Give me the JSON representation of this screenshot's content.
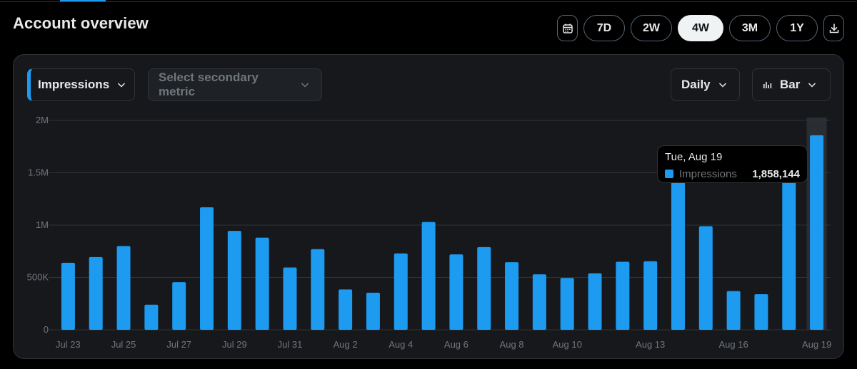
{
  "header": {
    "title": "Account overview",
    "range_buttons": [
      "7D",
      "2W",
      "4W",
      "3M",
      "1Y"
    ],
    "active_range": "4W"
  },
  "controls": {
    "primary_metric": "Impressions",
    "secondary_metric_placeholder": "Select secondary metric",
    "granularity": "Daily",
    "chart_type": "Bar"
  },
  "colors": {
    "accent": "#1d9bf0",
    "background": "#000000",
    "panel": "#16181c",
    "grid": "#2f3336",
    "muted_text": "#71767b"
  },
  "icons": [
    "calendar-icon",
    "download-icon",
    "chevron-down-icon",
    "bar-chart-icon"
  ],
  "tooltip": {
    "date": "Tue, Aug 19",
    "metric": "Impressions",
    "value": "1,858,144"
  },
  "chart_data": {
    "type": "bar",
    "series": [
      {
        "name": "Impressions",
        "values": [
          640000,
          695000,
          800000,
          240000,
          455000,
          1170000,
          945000,
          880000,
          595000,
          770000,
          385000,
          355000,
          730000,
          1030000,
          720000,
          790000,
          645000,
          530000,
          495000,
          540000,
          650000,
          655000,
          1620000,
          990000,
          370000,
          340000,
          1600000,
          1858144
        ]
      }
    ],
    "categories": [
      "Jul 23",
      "Jul 24",
      "Jul 25",
      "Jul 26",
      "Jul 27",
      "Jul 28",
      "Jul 29",
      "Jul 30",
      "Jul 31",
      "Aug 1",
      "Aug 2",
      "Aug 3",
      "Aug 4",
      "Aug 5",
      "Aug 6",
      "Aug 7",
      "Aug 8",
      "Aug 9",
      "Aug 10",
      "Aug 11",
      "Aug 12",
      "Aug 13",
      "Aug 14",
      "Aug 15",
      "Aug 16",
      "Aug 17",
      "Aug 18",
      "Aug 19"
    ],
    "xtick_labels": [
      "Jul 23",
      "Jul 25",
      "Jul 27",
      "Jul 29",
      "Jul 31",
      "Aug 2",
      "Aug 4",
      "Aug 6",
      "Aug 8",
      "Aug 10",
      "Aug 13",
      "Aug 16",
      "Aug 19"
    ],
    "xtick_positions": [
      0,
      2,
      4,
      6,
      8,
      10,
      12,
      14,
      16,
      18,
      21,
      24,
      27
    ],
    "ytick_labels": [
      "0",
      "500K",
      "1M",
      "1.5M",
      "2M"
    ],
    "ytick_values": [
      0,
      500000,
      1000000,
      1500000,
      2000000
    ],
    "ylim": [
      0,
      2000000
    ],
    "highlighted_index": 27,
    "grid": true
  }
}
